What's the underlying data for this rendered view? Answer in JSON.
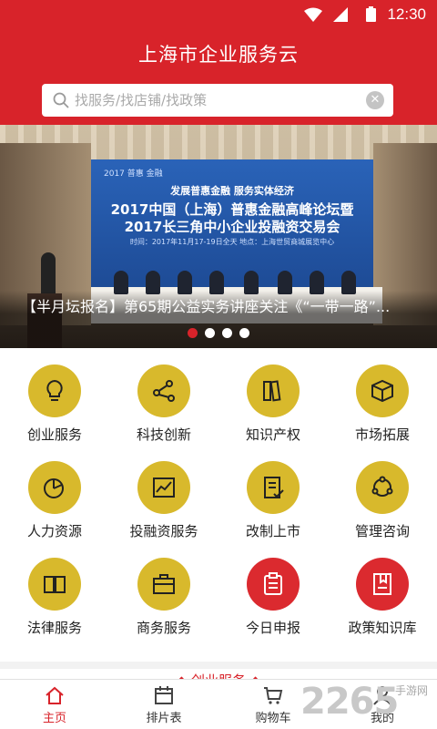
{
  "status_bar": {
    "time": "12:30",
    "wifi_icon": "wifi-icon",
    "signal_icon": "signal-icon",
    "battery_icon": "battery-icon"
  },
  "header": {
    "title": "上海市企业服务云"
  },
  "search": {
    "placeholder": "找服务/找店铺/找政策",
    "icon": "search-icon",
    "clear_icon": "clear-icon",
    "clear_glyph": "✕"
  },
  "banner": {
    "caption": "【半月坛报名】第65期公益实务讲座关注《“一带一路”...",
    "screen_line1": "发展普惠金融 服务实体经济",
    "screen_line2": "2017中国（上海）普惠金融高峰论坛暨",
    "screen_line3": "2017长三角中小企业投融资交易会",
    "screen_line4": "时间：2017年11月17-19日全天    地点：上海世贸商城展览中心",
    "screen_logos": "2017 普惠 金融",
    "slides": 4,
    "active_slide": 0
  },
  "services": [
    {
      "label": "创业服务",
      "icon": "lightbulb-icon",
      "color": "#d8b92c"
    },
    {
      "label": "科技创新",
      "icon": "share-nodes-icon",
      "color": "#d8b92c"
    },
    {
      "label": "知识产权",
      "icon": "books-icon",
      "color": "#d8b92c"
    },
    {
      "label": "市场拓展",
      "icon": "box-icon",
      "color": "#d8b92c"
    },
    {
      "label": "人力资源",
      "icon": "pie-chart-icon",
      "color": "#d8b92c"
    },
    {
      "label": "投融资服务",
      "icon": "line-chart-icon",
      "color": "#d8b92c"
    },
    {
      "label": "改制上市",
      "icon": "document-check-icon",
      "color": "#d8b92c"
    },
    {
      "label": "管理咨询",
      "icon": "cycle-icon",
      "color": "#d8b92c"
    },
    {
      "label": "法律服务",
      "icon": "open-book-icon",
      "color": "#d8b92c"
    },
    {
      "label": "商务服务",
      "icon": "briefcase-icon",
      "color": "#d8b92c"
    },
    {
      "label": "今日申报",
      "icon": "clipboard-icon",
      "color": "#db2a2f"
    },
    {
      "label": "政策知识库",
      "icon": "bookmark-book-icon",
      "color": "#db2a2f"
    }
  ],
  "section": {
    "title": "创业服务",
    "deco": "◆"
  },
  "tabbar": {
    "tabs": [
      {
        "label": "主页",
        "icon": "home-icon",
        "active": true
      },
      {
        "label": "排片表",
        "icon": "calendar-icon",
        "active": false
      },
      {
        "label": "购物车",
        "icon": "cart-icon",
        "active": false
      },
      {
        "label": "我的",
        "icon": "user-icon",
        "active": false
      }
    ]
  },
  "watermark": {
    "text": "2265",
    "sub": "手游网"
  },
  "colors": {
    "brand_red": "#d8232a",
    "icon_gold": "#d8b92c",
    "icon_red": "#db2a2f"
  }
}
